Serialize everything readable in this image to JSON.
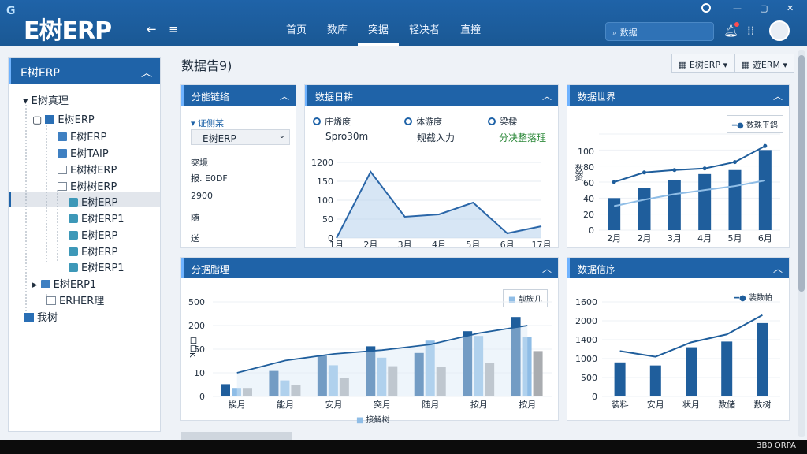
{
  "app": {
    "logo_mark": "G",
    "title": "E树ERP"
  },
  "window": {
    "minimize": "—",
    "restore": "▢",
    "close": "✕"
  },
  "nav": {
    "back_icon": "←",
    "menu_icon": "≡",
    "tabs": [
      {
        "label": "首页",
        "active": false
      },
      {
        "label": "数库",
        "active": false
      },
      {
        "label": "突据",
        "active": true
      },
      {
        "label": "轻决者",
        "active": false
      },
      {
        "label": "直撞",
        "active": false
      }
    ],
    "search_placeholder": "数据"
  },
  "sidebar": {
    "title": "E树ERP",
    "items": [
      {
        "label": "E树真理"
      },
      {
        "label": "E树ERP"
      },
      {
        "label": "E树ERP"
      },
      {
        "label": "E树TAIP"
      },
      {
        "label": "E树树ERP"
      },
      {
        "label": "E树树ERP"
      },
      {
        "label": "E树ERP"
      },
      {
        "label": "E树ERP1"
      },
      {
        "label": "E树ERP"
      },
      {
        "label": "E树ERP"
      },
      {
        "label": "E树ERP1"
      },
      {
        "label": "E树ERP1"
      },
      {
        "label": "ERHER理"
      },
      {
        "label": "我树"
      }
    ]
  },
  "page": {
    "title": "数据告9)",
    "btn1": "E树ERP",
    "btn2": "遊ERM"
  },
  "panel_filter": {
    "title": "分能链络",
    "label": "证侧某",
    "select_value": "E树ERP",
    "lines": [
      "突境",
      "报. E0DF",
      "2900",
      "随",
      "送"
    ]
  },
  "panel_line": {
    "title": "数据日耕",
    "radios": [
      {
        "label": "庄烯度",
        "value": "Spro30m"
      },
      {
        "label": "体游度",
        "value": "规截入力"
      },
      {
        "label": "梁樑",
        "value": "分决整落理"
      }
    ]
  },
  "panel_combo_top": {
    "title": "数据世界",
    "legend": "数珠平鸽",
    "ylabel": "数资"
  },
  "panel_grouped": {
    "title": "分据脂理",
    "legend_top": "靓族几",
    "legend_bottom": "接解树",
    "ylabel": "口口K"
  },
  "panel_combo_bottom": {
    "title": "数据信序",
    "legend": "装数帕"
  },
  "status": {
    "text": "3B0 ORPA"
  },
  "colors": {
    "primary": "#1f63a8",
    "bar_dark": "#1f5e9c",
    "bar_light": "#8fbde6",
    "bar_gray": "#a9acb0"
  },
  "chart_data": [
    {
      "type": "area",
      "categories": [
        "1月",
        "2月",
        "3月",
        "4月",
        "5月",
        "6月",
        "17月"
      ],
      "yticks": [
        0,
        50,
        100,
        150,
        1200
      ],
      "series": [
        {
          "values": [
            0,
            140,
            45,
            50,
            75,
            10,
            25
          ]
        }
      ]
    },
    {
      "type": "bar",
      "categories": [
        "2月",
        "2月",
        "3月",
        "4月",
        "5月",
        "6月"
      ],
      "yticks": [
        0,
        20,
        40,
        60,
        80,
        100,
        120
      ],
      "series": [
        {
          "name": "数珠平鸽",
          "kind": "bar",
          "values": [
            40,
            53,
            62,
            70,
            75,
            100
          ]
        },
        {
          "kind": "line",
          "values": [
            60,
            72,
            75,
            77,
            85,
            105
          ]
        },
        {
          "kind": "line",
          "values": [
            30,
            38,
            45,
            50,
            55,
            62
          ]
        }
      ]
    },
    {
      "type": "bar",
      "categories": [
        "挨月",
        "能月",
        "安月",
        "突月",
        "随月",
        "按月",
        "按月"
      ],
      "yticks": [
        0,
        10,
        50,
        200,
        500
      ],
      "series": [
        {
          "kind": "bar",
          "values": [
            13,
            27,
            43,
            53,
            46,
            69,
            84
          ]
        },
        {
          "kind": "bar",
          "values": [
            9,
            17,
            33,
            41,
            59,
            64,
            63
          ]
        },
        {
          "kind": "bar",
          "values": [
            9,
            12,
            20,
            32,
            31,
            35,
            48
          ]
        },
        {
          "kind": "line",
          "values": [
            25,
            38,
            45,
            49,
            55,
            67,
            75
          ]
        }
      ]
    },
    {
      "type": "bar",
      "categories": [
        "装料",
        "安月",
        "状月",
        "数储",
        "数树"
      ],
      "yticks": [
        0,
        500,
        1000,
        1400,
        2000,
        1600
      ],
      "series": [
        {
          "kind": "bar",
          "values": [
            900,
            820,
            1300,
            1450,
            1940
          ]
        },
        {
          "name": "装数帕",
          "kind": "line",
          "values": [
            1200,
            1050,
            1430,
            1640,
            2150
          ]
        }
      ]
    }
  ]
}
